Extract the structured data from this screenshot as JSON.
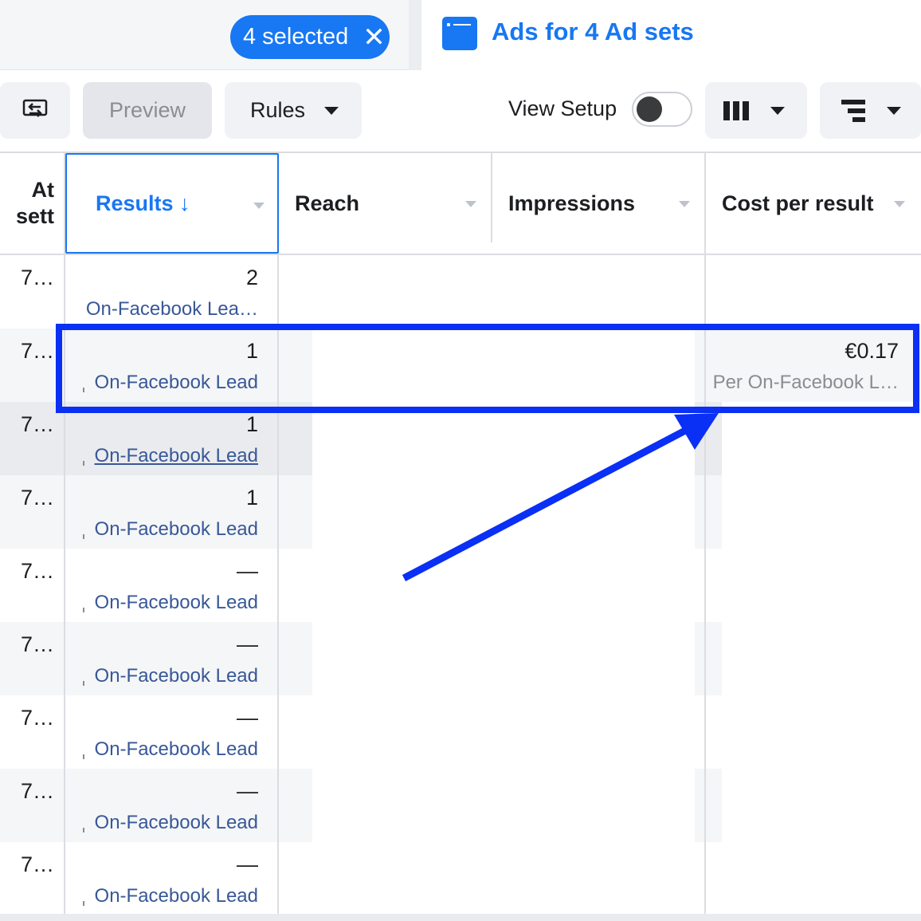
{
  "tabs": {
    "selection_label": "4 selected",
    "close_glyph": "✕",
    "active_title": "Ads for 4 Ad sets",
    "active_icon": "browser-window-icon",
    "accent_color": "#1877f2"
  },
  "toolbar": {
    "export_icon": "export-icon",
    "preview_label": "Preview",
    "rules_label": "Rules",
    "view_setup_label": "View Setup",
    "view_setup_on": false,
    "columns_icon": "columns-icon",
    "breakdown_icon": "breakdown-icon"
  },
  "table": {
    "columns": [
      {
        "label": "At\nsett"
      },
      {
        "label": "Results ↓",
        "sorted": true
      },
      {
        "label": "Reach"
      },
      {
        "label": "Impressions"
      },
      {
        "label": "Cost per result"
      }
    ],
    "rows": [
      {
        "name": "7…",
        "results": "2",
        "result_type": "On-Facebook Lea…",
        "cost": "",
        "cost_type": ""
      },
      {
        "name": "7…",
        "results": "1",
        "result_type": "On-Facebook Lead",
        "cost": "€0.17",
        "cost_type": "Per On-Facebook L…"
      },
      {
        "name": "7…",
        "results": "1",
        "result_type": "On-Facebook Lead",
        "cost": "",
        "cost_type": ""
      },
      {
        "name": "7…",
        "results": "1",
        "result_type": "On-Facebook Lead",
        "cost": "",
        "cost_type": ""
      },
      {
        "name": "7…",
        "results": "—",
        "result_type": "On-Facebook Lead",
        "cost": "",
        "cost_type": ""
      },
      {
        "name": "7…",
        "results": "—",
        "result_type": "On-Facebook Lead",
        "cost": "",
        "cost_type": ""
      },
      {
        "name": "7…",
        "results": "—",
        "result_type": "On-Facebook Lead",
        "cost": "",
        "cost_type": ""
      },
      {
        "name": "7…",
        "results": "—",
        "result_type": "On-Facebook Lead",
        "cost": "",
        "cost_type": ""
      },
      {
        "name": "7…",
        "results": "—",
        "result_type": "On-Facebook Lead",
        "cost": "",
        "cost_type": ""
      }
    ]
  },
  "annotation": {
    "color": "#0a2ff5"
  }
}
